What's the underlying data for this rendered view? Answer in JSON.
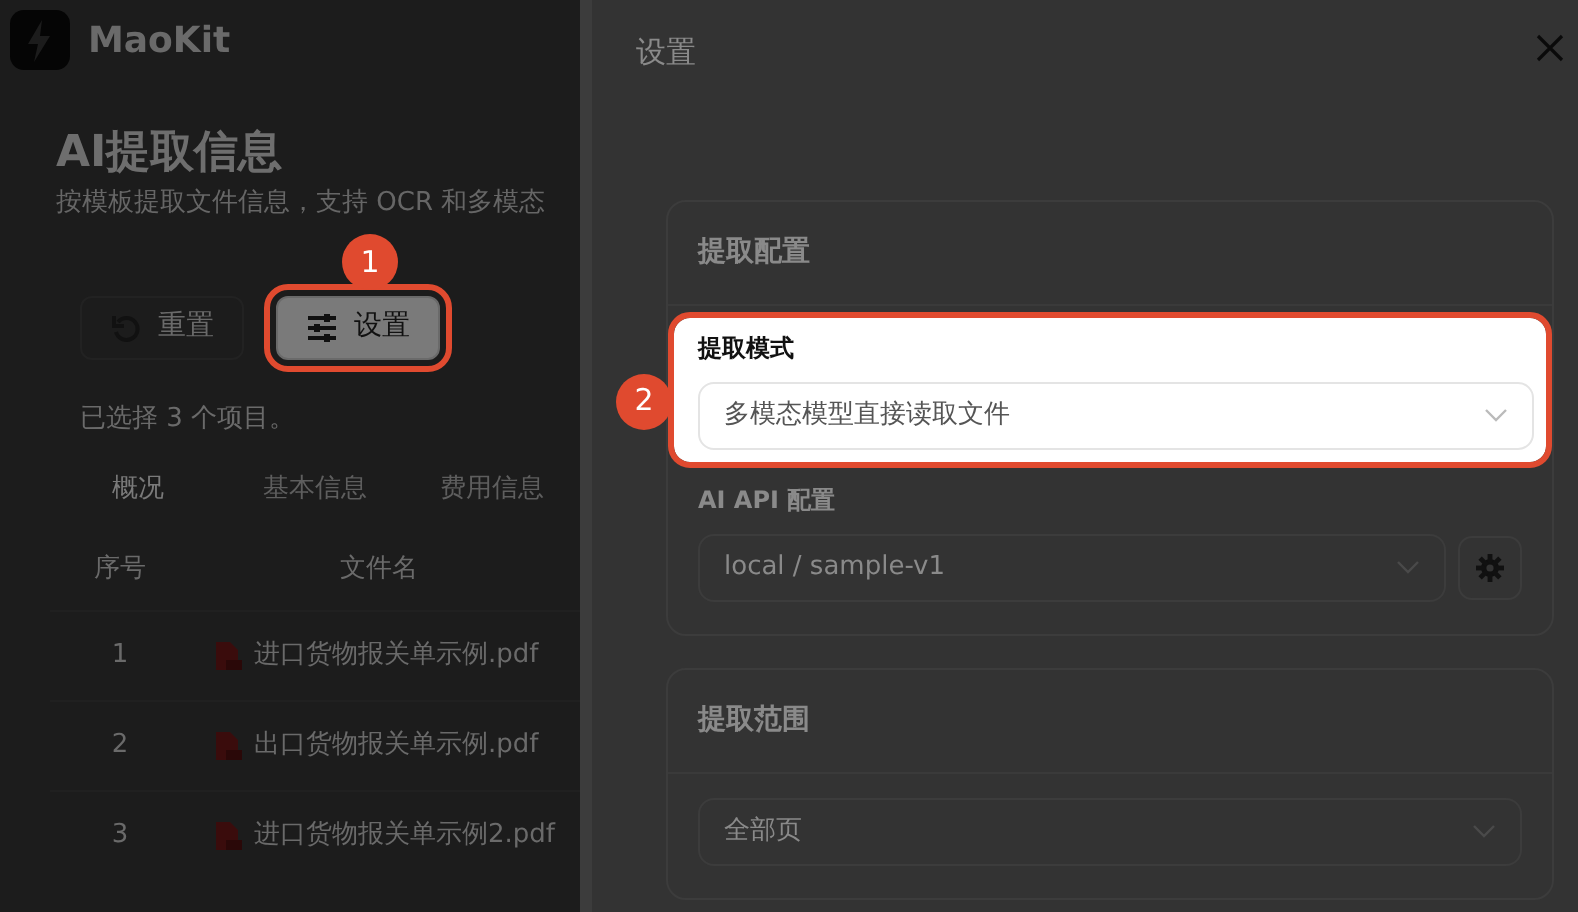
{
  "app": {
    "name": "MaoKit"
  },
  "page": {
    "title": "AI提取信息",
    "subtitle": "按模板提取文件信息，支持 OCR 和多模态"
  },
  "toolbar": [
    {
      "label": "重置",
      "kind": "reset"
    },
    {
      "label": "设置",
      "kind": "settings",
      "step": "1"
    }
  ],
  "selection_note": "已选择 3 个项目。",
  "tabs": [
    {
      "label": "概况",
      "selected": true
    },
    {
      "label": "基本信息",
      "selected": false
    },
    {
      "label": "费用信息",
      "selected": false
    }
  ],
  "table": {
    "columns": [
      "序号",
      "文件名"
    ],
    "rows": [
      {
        "index": "1",
        "file": "进口货物报关单示例.pdf"
      },
      {
        "index": "2",
        "file": "出口货物报关单示例.pdf"
      },
      {
        "index": "3",
        "file": "进口货物报关单示例2.pdf"
      }
    ]
  },
  "drawer": {
    "title": "设置",
    "sections": [
      {
        "title": "提取配置",
        "fields": [
          {
            "label": "提取模式",
            "value": "多模态模型直接读取文件",
            "kind": "select",
            "step": "2"
          },
          {
            "label": "AI API 配置",
            "value": "local / sample-v1",
            "kind": "select_with_settings"
          }
        ]
      },
      {
        "title": "提取范围",
        "fields": [
          {
            "value": "全部页",
            "kind": "select"
          }
        ]
      }
    ]
  }
}
